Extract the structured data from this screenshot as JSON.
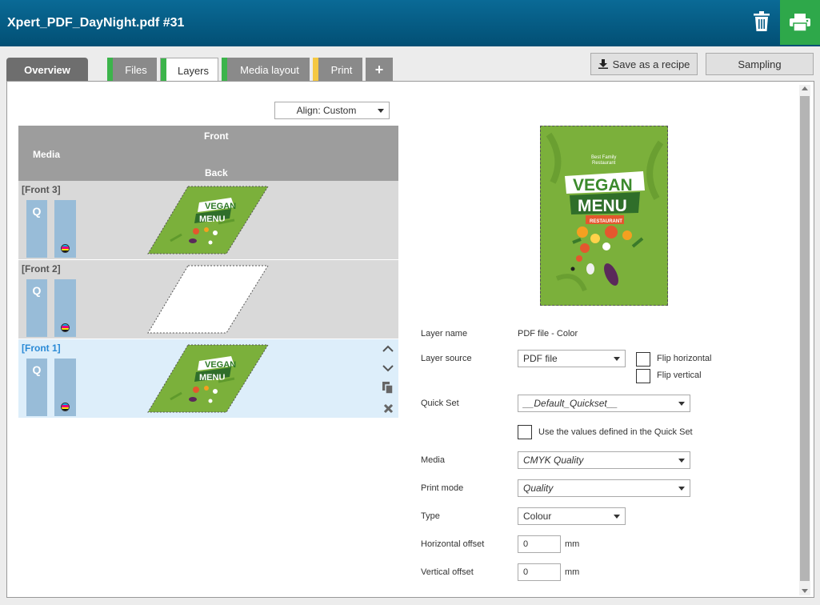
{
  "title": "Xpert_PDF_DayNight.pdf #31",
  "icons": {
    "trash": "trash-icon",
    "print": "printer-icon"
  },
  "colors": {
    "accent_green": "#2ea84a",
    "tab_yellow": "#f5c842",
    "header_blue": "#045b85",
    "selected_blue": "#2a8ad6"
  },
  "tabs": [
    {
      "label": "Overview"
    },
    {
      "label": "Files"
    },
    {
      "label": "Layers"
    },
    {
      "label": "Media layout"
    },
    {
      "label": "Print"
    },
    {
      "label": "+"
    }
  ],
  "actions": {
    "save_recipe": "Save as a recipe",
    "sampling": "Sampling"
  },
  "align": {
    "value": "Align: Custom"
  },
  "table": {
    "front": "Front",
    "media": "Media",
    "back": "Back"
  },
  "layers": [
    {
      "name": "[Front 3]",
      "quick": "Q"
    },
    {
      "name": "[Front 2]",
      "quick": "Q"
    },
    {
      "name": "[Front 1]",
      "quick": "Q"
    }
  ],
  "preview": {
    "line1": "Best Family",
    "line2": "Restaurant",
    "vegan": "VEGAN",
    "menu": "MENU",
    "restaurant": "RESTAURANT"
  },
  "thumb": {
    "vegan": "VEGAN",
    "menu": "MENU"
  },
  "form": {
    "layer_name_label": "Layer name",
    "layer_name_value": "PDF file - Color",
    "layer_source_label": "Layer source",
    "layer_source_value": "PDF file",
    "flip_h": "Flip horizontal",
    "flip_v": "Flip vertical",
    "quickset_label": "Quick Set",
    "quickset_value": "__Default_Quickset__",
    "use_quickset": "Use the values defined in the Quick Set",
    "media_label": "Media",
    "media_value": "CMYK Quality",
    "print_mode_label": "Print mode",
    "print_mode_value": "Quality",
    "type_label": "Type",
    "type_value": "Colour",
    "h_offset_label": "Horizontal offset",
    "h_offset_value": "0",
    "v_offset_label": "Vertical offset",
    "v_offset_value": "0",
    "unit": "mm"
  }
}
